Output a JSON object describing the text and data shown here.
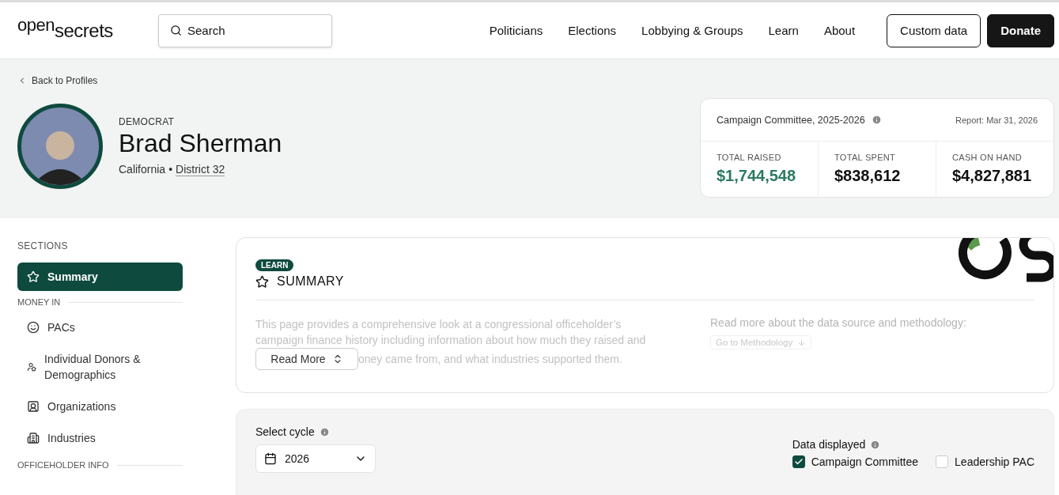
{
  "header": {
    "logo": {
      "part_1": "open",
      "part_2": "secrets"
    },
    "search": {
      "placeholder": "Search"
    },
    "nav": [
      "Politicians",
      "Elections",
      "Lobbying & Groups",
      "Learn",
      "About"
    ],
    "buttons": [
      {
        "label": "Custom data",
        "kind": "outline"
      },
      {
        "label": "Donate",
        "kind": "filled"
      }
    ]
  },
  "profile": {
    "back_link": "Back to Profiles",
    "party": "DEMOCRAT",
    "name": "Brad Sherman",
    "state": "California",
    "separator": "•",
    "district": "District 32"
  },
  "finance_card": {
    "title": "Campaign Committee, 2025-2026",
    "report": "Report: Mar 31, 2026",
    "stats": [
      {
        "label": "TOTAL RAISED",
        "value": "$1,744,548",
        "highlight": true
      },
      {
        "label": "TOTAL SPENT",
        "value": "$838,612",
        "highlight": false
      },
      {
        "label": "CASH ON HAND",
        "value": "$4,827,881",
        "highlight": false
      }
    ]
  },
  "sidebar": {
    "heading": "SECTIONS",
    "groups": [
      {
        "items": [
          {
            "label": "Summary",
            "selected": true
          }
        ]
      },
      {
        "title": "MONEY IN",
        "items": [
          {
            "label": "PACs",
            "selected": false
          },
          {
            "label": "Individual Donors & Demographics",
            "selected": false
          },
          {
            "label": "Organizations",
            "selected": false
          },
          {
            "label": "Industries",
            "selected": false
          }
        ]
      },
      {
        "title": "OFFICEHOLDER INFO"
      }
    ]
  },
  "summary": {
    "badge": "LEARN",
    "title": "SUMMARY",
    "description": "This page provides a comprehensive look at a congressional officeholder’s campaign finance history including information about how much they raised and",
    "description_tail": "oney came from, and what industries supported them.",
    "read_more": "Read More",
    "methodology_text": "Read more about the data source and methodology:",
    "methodology_link": "Go to Methodology"
  },
  "filters": {
    "cycle_label": "Select cycle",
    "cycle_value": "2026",
    "data_label": "Data displayed",
    "options": [
      {
        "label": "Campaign Committee",
        "checked": true
      },
      {
        "label": "Leadership PAC",
        "checked": false
      }
    ]
  }
}
